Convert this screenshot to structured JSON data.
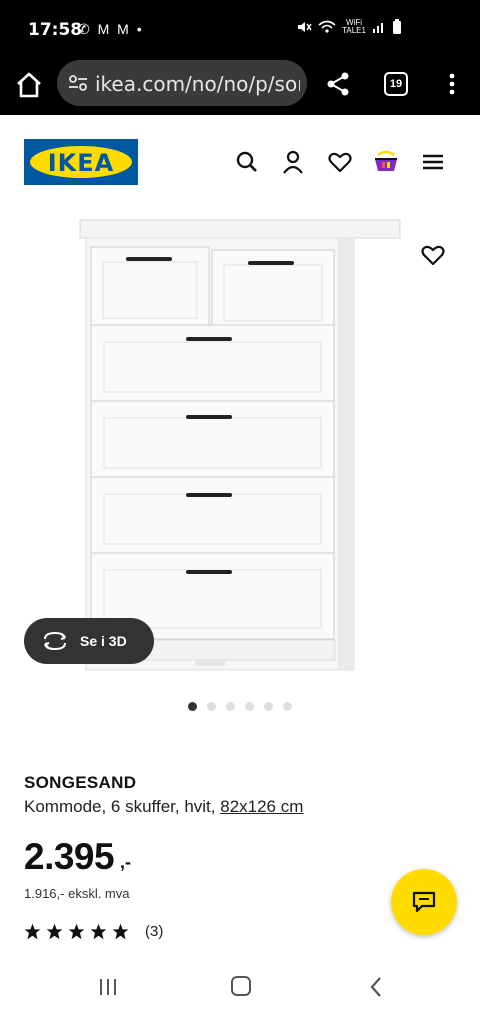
{
  "status_bar": {
    "time": "17:58",
    "notification_icons": "✆ M M •",
    "wifi_label": "WiFi TALE1"
  },
  "browser": {
    "url": "ikea.com/no/no/p/son",
    "tab_count": "19"
  },
  "header": {
    "logo_text": "IKEA",
    "icons": [
      "search-icon",
      "user-icon",
      "heart-icon",
      "basket-icon",
      "menu-icon"
    ]
  },
  "product": {
    "view_3d_label": "Se i 3D",
    "carousel_total": 6,
    "carousel_active": 0,
    "name": "SONGESAND",
    "description": "Kommode, 6 skuffer, hvit, ",
    "dimensions": "82x126 cm",
    "price": "2.395",
    "price_suffix": ",-",
    "price_excl": "1.916,- ekskl. mva",
    "rating_stars": 5,
    "rating_count": "(3)"
  },
  "colors": {
    "ikea_blue": "#0058a3",
    "ikea_yellow": "#ffdb00",
    "dark_button": "#333333"
  }
}
